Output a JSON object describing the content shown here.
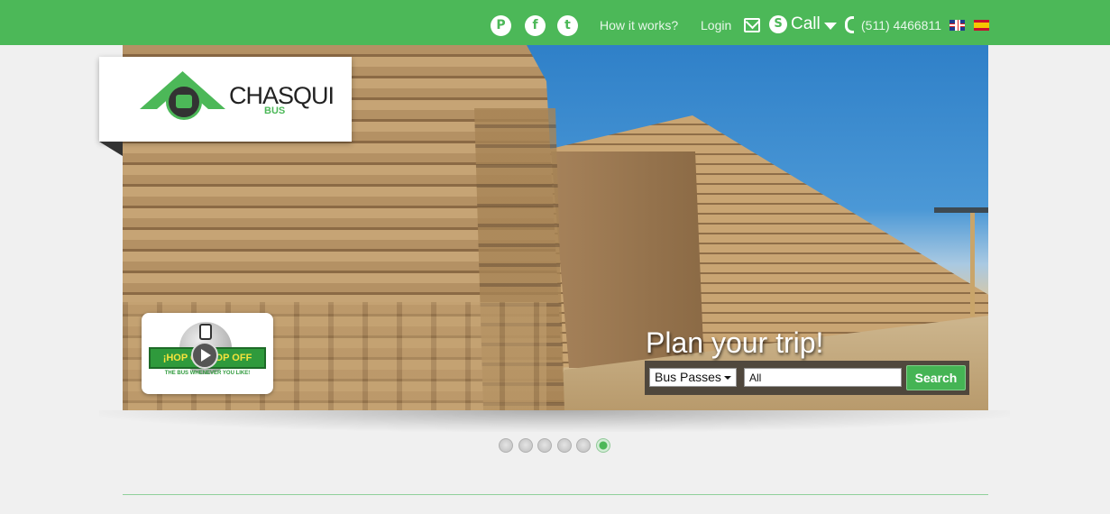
{
  "header": {
    "social": {
      "pinterest_glyph": "P",
      "facebook_glyph": "f",
      "twitter_glyph": "t"
    },
    "nav": {
      "how_it_works": "How it works?",
      "login": "Login"
    },
    "call_label": "Call",
    "phone": "(511) 4466811",
    "icons": [
      "pinterest-icon",
      "facebook-icon",
      "twitter-icon",
      "mail-icon",
      "skype-icon",
      "chevron-down-icon",
      "phone-icon",
      "flag-uk-icon",
      "flag-es-icon"
    ]
  },
  "logo": {
    "name": "CHASQUI",
    "sub": "BUS"
  },
  "hop": {
    "banner": "¡HOP ON HOP OFF",
    "tagline": "THE BUS WHENEVER YOU LIKE!"
  },
  "plan": {
    "title": "Plan your trip!",
    "select_value": "Bus Passes",
    "input_value": "All",
    "search_label": "Search"
  },
  "slider": {
    "count": 6,
    "active_index": 5
  },
  "colors": {
    "brand_green": "#4cb858",
    "bar_text": "#e8f7ea"
  }
}
